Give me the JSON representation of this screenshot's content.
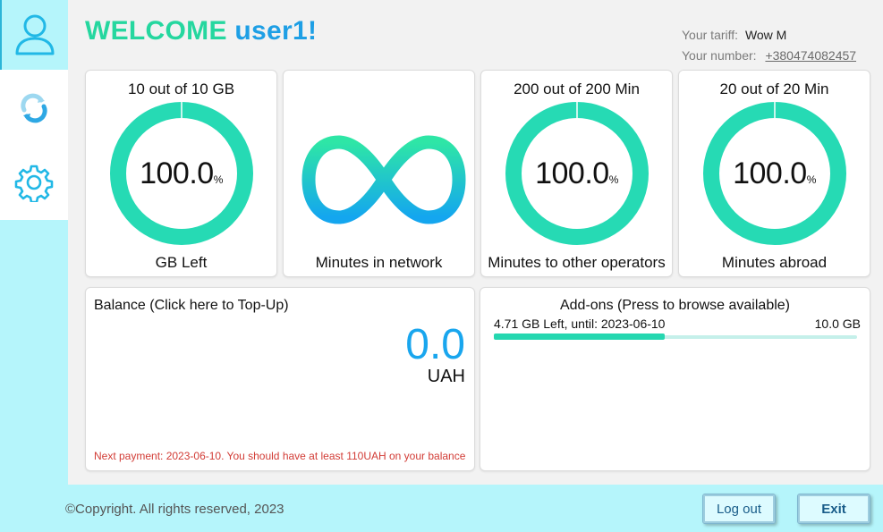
{
  "welcome": {
    "word": "WELCOME",
    "user": "user1",
    "suffix": "!"
  },
  "account": {
    "tariff_label": "Your tariff:",
    "tariff_value": "Wow M",
    "number_label": "Your number:",
    "number_value": "+380474082457"
  },
  "sidebar": {
    "items": [
      {
        "icon": "user-icon",
        "active": true
      },
      {
        "icon": "sync-icon",
        "active": false
      },
      {
        "icon": "gear-icon",
        "active": false
      }
    ]
  },
  "cards": [
    {
      "title": "10 out of 10 GB",
      "percent": "100.0",
      "percent_sign": "%",
      "fraction": 1.0,
      "footer": "GB Left"
    },
    {
      "title": "",
      "icon": "infinity-icon",
      "footer": "Minutes in network"
    },
    {
      "title": "200 out of 200 Min",
      "percent": "100.0",
      "percent_sign": "%",
      "fraction": 1.0,
      "footer": "Minutes to other operators"
    },
    {
      "title": "20 out of 20 Min",
      "percent": "100.0",
      "percent_sign": "%",
      "fraction": 1.0,
      "footer": "Minutes abroad"
    }
  ],
  "balance": {
    "title": "Balance (Click here to Top-Up)",
    "amount": "0.0",
    "currency": "UAH",
    "note": "Next payment: 2023-06-10. You should have at least 110UAH on your balance"
  },
  "addons": {
    "title": "Add-ons (Press to browse available)",
    "left_label": "4.71 GB Left, until: 2023-06-10",
    "total_label": "10.0 GB",
    "fraction": 0.471
  },
  "footer": {
    "copyright": "©Copyright. All rights reserved, 2023",
    "logout_label": "Log out",
    "exit_label": "Exit"
  },
  "colors": {
    "accent_green": "#25d79f",
    "accent_blue": "#1e9fe5",
    "warning": "#d23c36"
  }
}
